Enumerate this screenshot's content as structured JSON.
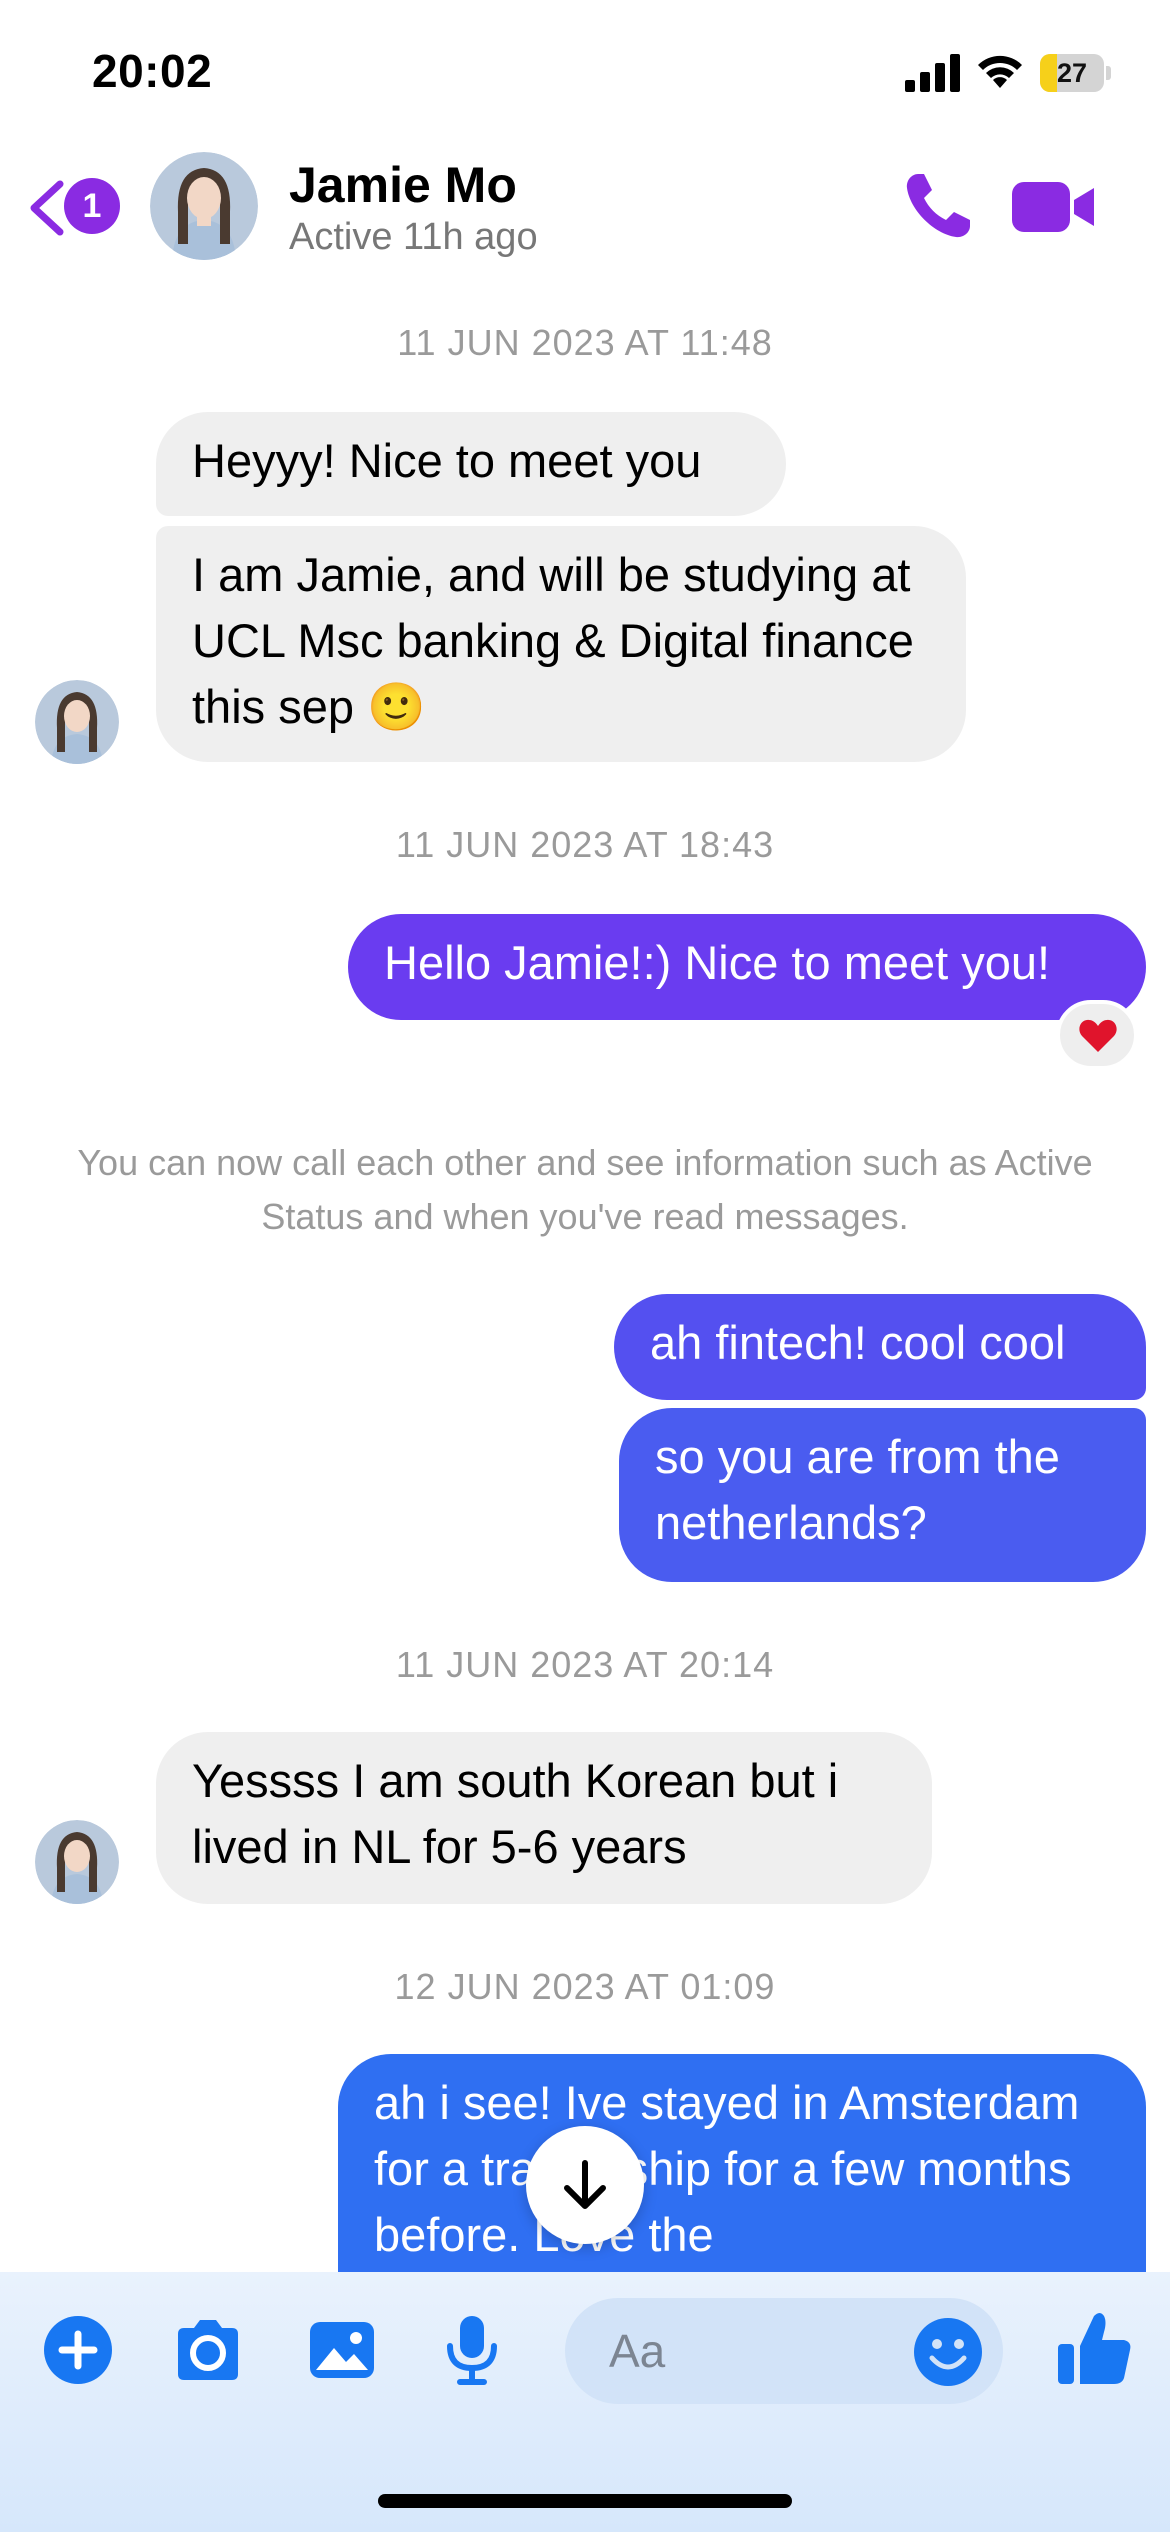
{
  "status_bar": {
    "time": "20:02",
    "battery": "27"
  },
  "header": {
    "unread_badge": "1",
    "contact_name": "Jamie Mo",
    "contact_status": "Active 11h ago"
  },
  "messages": {
    "ts1": "11 JUN 2023 AT 11:48",
    "in1": "Heyyy! Nice to meet you",
    "in2": "I am Jamie, and will be studying at UCL Msc banking & Digital finance this sep 🙂",
    "ts2": "11 JUN 2023 AT 18:43",
    "out1": "Hello Jamie!:) Nice to meet you!",
    "out1_reaction": "❤️",
    "system_notice": "You can now call each other and see information such as Active Status and when you've read messages.",
    "out2": "ah fintech! cool cool",
    "out3": "so you are from the netherlands?",
    "ts3": "11 JUN 2023 AT 20:14",
    "in3": "Yessss I am south Korean but i lived in NL for 5-6 years",
    "ts4": "12 JUN 2023 AT 01:09",
    "out4": "ah i see! Ive stayed in Amsterdam for a traineeship for a few months before. Love the"
  },
  "composer": {
    "placeholder": "Aa"
  },
  "colors": {
    "accent_purple": "#8a2be2",
    "bubble_purple": "#6a3cf0",
    "bubble_indigo": "#4f5bf0",
    "bubble_blue": "#2f6ff2",
    "composer_icon_blue": "#1877f2"
  },
  "icons": [
    "signal-icon",
    "wifi-icon",
    "battery-icon",
    "back-chevron-icon",
    "phone-icon",
    "video-camera-icon",
    "heart-reaction",
    "arrow-down-icon",
    "plus-icon",
    "camera-icon",
    "gallery-icon",
    "microphone-icon",
    "smiley-icon",
    "thumbs-up-icon"
  ]
}
